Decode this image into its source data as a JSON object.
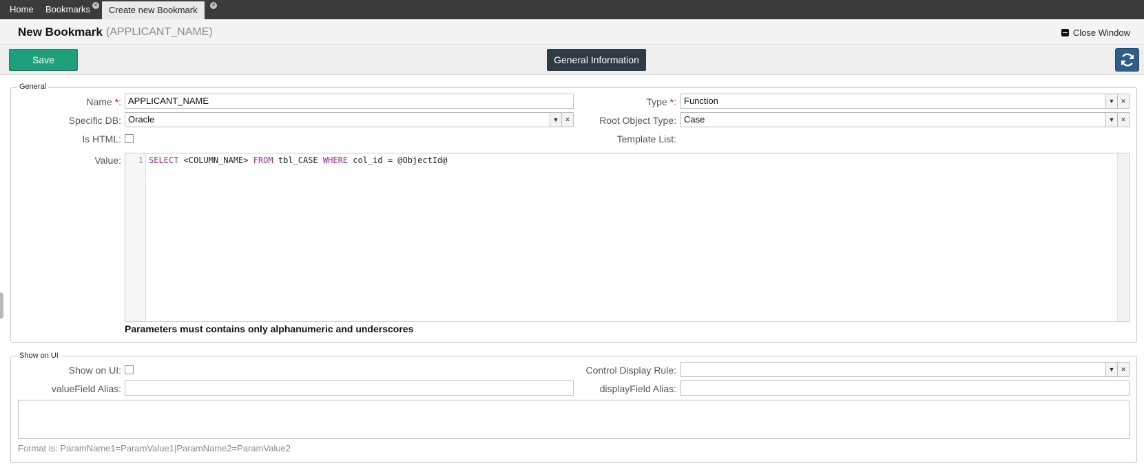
{
  "tabs": [
    {
      "label": "Home",
      "closable": false,
      "active": false
    },
    {
      "label": "Bookmarks",
      "closable": true,
      "active": false
    },
    {
      "label": "Create new Bookmark",
      "closable": true,
      "active": true
    }
  ],
  "header": {
    "title": "New Bookmark",
    "subtitle": "(APPLICANT_NAME)",
    "close_label": "Close Window"
  },
  "toolbar": {
    "save_label": "Save",
    "section_label": "General Information"
  },
  "general": {
    "legend": "General",
    "name_label": "Name",
    "name_value": "APPLICANT_NAME",
    "type_label": "Type",
    "type_value": "Function",
    "specific_db_label": "Specific DB:",
    "specific_db_value": "Oracle",
    "root_object_label": "Root Object Type:",
    "root_object_value": "Case",
    "is_html_label": "Is HTML:",
    "is_html_checked": false,
    "template_list_label": "Template List:",
    "value_label": "Value:",
    "code": {
      "line_number": "1",
      "kw_select": "SELECT",
      "t1": " <COLUMN_NAME> ",
      "kw_from": "FROM",
      "t2": " tbl_CASE ",
      "kw_where": "WHERE",
      "t3": " col_id = @ObjectId@"
    },
    "hint": "Parameters must contains only alphanumeric and underscores"
  },
  "show_on_ui": {
    "legend": "Show on UI",
    "show_label": "Show on UI:",
    "show_checked": false,
    "control_rule_label": "Control Display Rule:",
    "control_rule_value": "",
    "value_alias_label": "valueField Alias:",
    "value_alias_value": "",
    "display_alias_label": "displayField Alias:",
    "display_alias_value": "",
    "params_value": "",
    "format_hint": "Format is: ParamName1=ParamValue1|ParamName2=ParamValue2"
  },
  "colors": {
    "save": "#1fa07a",
    "section_button": "#2f3b44",
    "refresh": "#2f5f86",
    "keyword": "#a0249a",
    "required": "#dd0000"
  }
}
